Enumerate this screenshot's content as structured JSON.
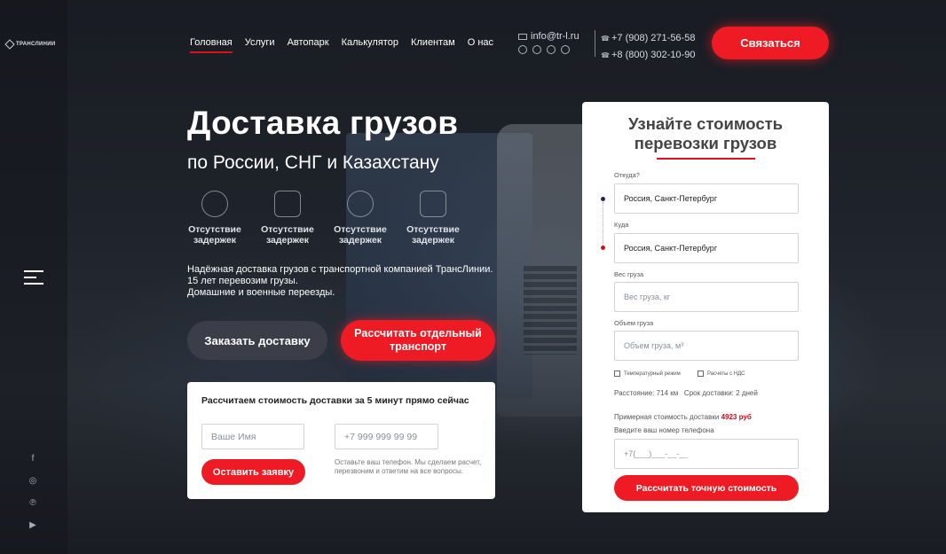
{
  "brand": {
    "logo_text": "ТРАНСЛИНИИ"
  },
  "nav": {
    "items": [
      {
        "label": "Головная"
      },
      {
        "label": "Услуги"
      },
      {
        "label": "Автопарк"
      },
      {
        "label": "Калькулятор"
      },
      {
        "label": "Клиентам"
      },
      {
        "label": "О нас"
      }
    ],
    "active_index": 0
  },
  "contacts": {
    "email": "info@tr-l.ru",
    "phone_1": "+7 (908) 271-56-58",
    "phone_2": "+8 (800) 302-10-90",
    "messenger_icons": [
      "vk-icon",
      "whatsapp-icon",
      "whatsapp-icon",
      "instagram-icon"
    ]
  },
  "header": {
    "contact_button": "Связаться"
  },
  "hero": {
    "title": "Доставка грузов",
    "subtitle": "по России, СНГ и Казахстану",
    "features": [
      {
        "icon": "stopwatch-icon",
        "label": "Отсутствие задержек"
      },
      {
        "icon": "clipboard-icon",
        "label": "Отсутствие задержек"
      },
      {
        "icon": "manager-icon",
        "label": "Отсутствие задержек"
      },
      {
        "icon": "door-icon",
        "label": "Отсутствие задержек"
      }
    ],
    "description_line_1": "Надёжная доставка грузов с транспортной компанией ТрансЛинии.",
    "description_line_2": "15 лет перевозим грузы.",
    "description_line_3": "Домашние и военные переезды.",
    "order_button": "Заказать доставку",
    "calc_button": "Рассчитать отдельный транспорт"
  },
  "quick_form": {
    "title": "Рассчитаем стоимость доставки за 5 минут прямо сейчас",
    "name_placeholder": "Ваше Имя",
    "phone_placeholder": "+7 999 999 99 99",
    "submit_button": "Оставить заявку",
    "note": "Оставьте ваш телефон. Мы сделаем расчет, перезвоним и ответим на все вопросы."
  },
  "calculator": {
    "title_line_1": "Узнайте стоимость",
    "title_line_2": "перевозки грузов",
    "from_label": "Откуда?",
    "from_value": "Россия, Санкт-Петербург",
    "to_label": "Куда",
    "to_value": "Россия, Санкт-Петербург",
    "weight_label": "Вес груза",
    "weight_placeholder": "Вес груза, кг",
    "volume_label": "Объем груза",
    "volume_placeholder": "Объем груза, м³",
    "checkbox_1": "Температурный режим",
    "checkbox_2": "Расчеты с НДС",
    "distance_label": "Расстояние:",
    "distance_value": "714 км",
    "term_label": "Срок доставки:",
    "term_value": "2 дней",
    "price_label": "Примерная стоимость доставки",
    "price_value": "4923 руб",
    "phone_label": "Введите ваш номер телефона",
    "phone_placeholder": "+7(___)___-__-__",
    "submit_button": "Рассчитать точную стоимость"
  },
  "sidebar": {
    "social_icons": [
      "facebook-icon",
      "instagram-icon",
      "pinterest-icon",
      "youtube-icon"
    ]
  },
  "colors": {
    "accent": "#ee1b24",
    "dark_button": "#3b3d48",
    "background": "#1c1f26"
  }
}
